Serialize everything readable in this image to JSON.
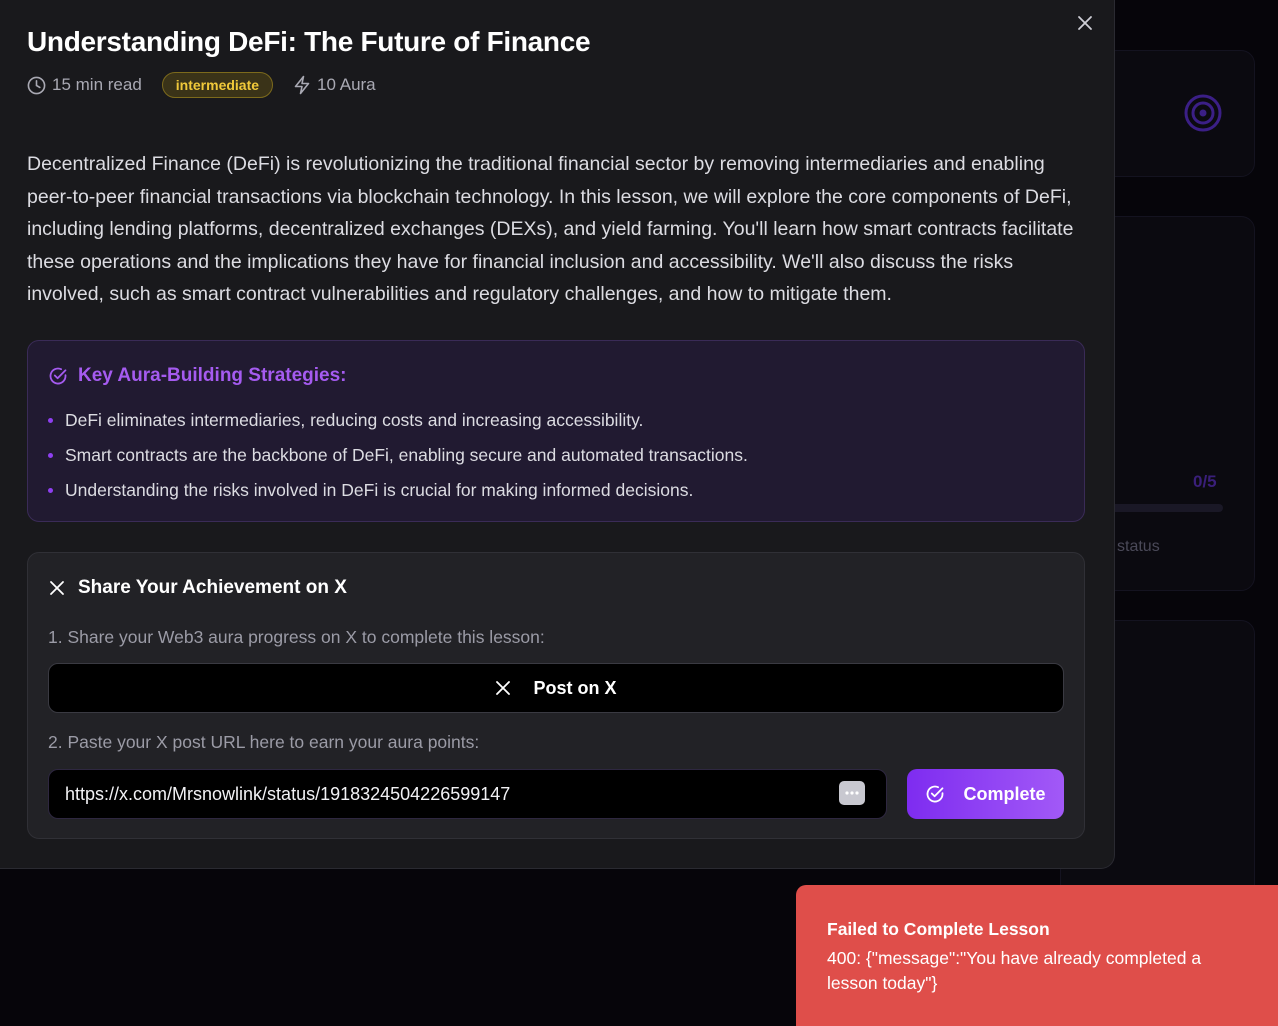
{
  "background": {
    "progress_count": "0/5",
    "status_text": "status"
  },
  "modal": {
    "title": "Understanding DeFi: The Future of Finance",
    "meta": {
      "read_time": "15 min read",
      "level": "intermediate",
      "reward": "10 Aura"
    },
    "description": "Decentralized Finance (DeFi) is revolutionizing the traditional financial sector by removing intermediaries and enabling peer-to-peer financial transactions via blockchain technology. In this lesson, we will explore the core components of DeFi, including lending platforms, decentralized exchanges (DEXs), and yield farming. You'll learn how smart contracts facilitate these operations and the implications they have for financial inclusion and accessibility. We'll also discuss the risks involved, such as smart contract vulnerabilities and regulatory challenges, and how to mitigate them.",
    "strategies": {
      "title": "Key Aura-Building Strategies:",
      "items": [
        "DeFi eliminates intermediaries, reducing costs and increasing accessibility.",
        "Smart contracts are the backbone of DeFi, enabling secure and automated transactions.",
        "Understanding the risks involved in DeFi is crucial for making informed decisions."
      ]
    },
    "share": {
      "title": "Share Your Achievement on X",
      "step1": "1. Share your Web3 aura progress on X to complete this lesson:",
      "post_button": "Post on X",
      "step2": "2. Paste your X post URL here to earn your aura points:",
      "url_value": "https://x.com/Mrsnowlink/status/1918324504226599147",
      "complete_button": "Complete"
    }
  },
  "toast": {
    "title": "Failed to Complete Lesson",
    "message": "400: {\"message\":\"You have already completed a lesson today\"}"
  },
  "colors": {
    "accent": "#8e3ff0",
    "badge_text": "#f0c93a",
    "error": "#df4e4a"
  }
}
